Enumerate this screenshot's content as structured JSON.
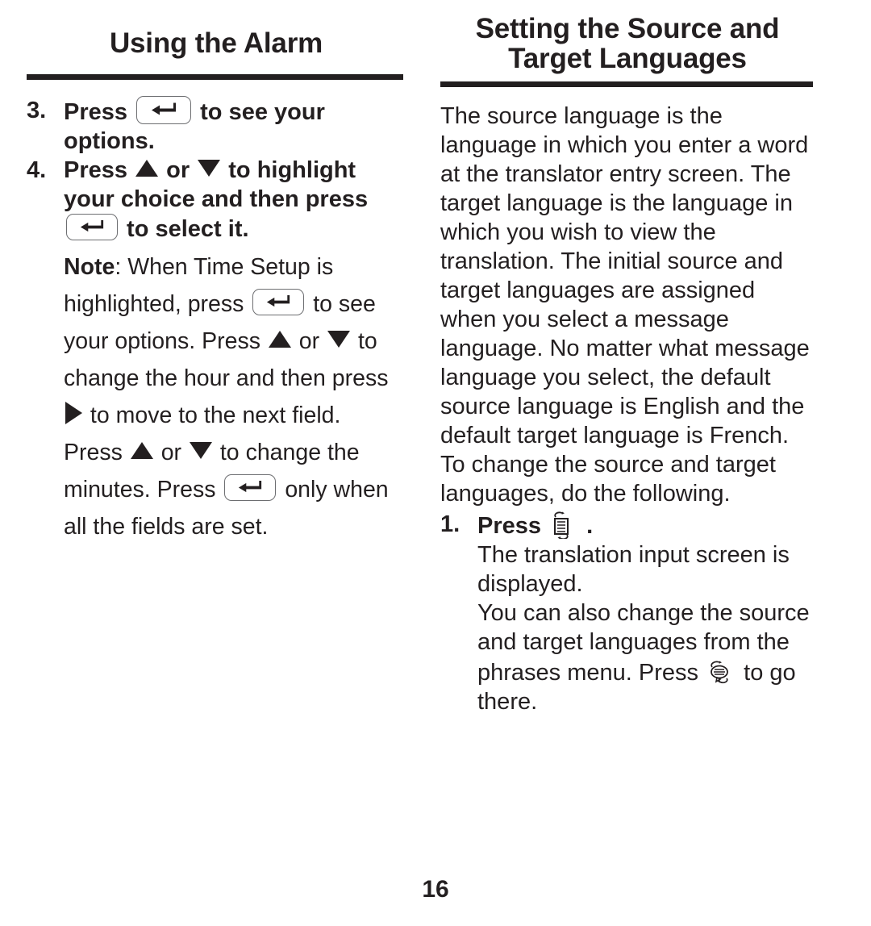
{
  "page": {
    "number": "16",
    "text_color": "#231f20",
    "rule_color": "#231f20"
  },
  "left_column": {
    "heading": "Using the Alarm",
    "steps": [
      {
        "number": "3.",
        "parts": [
          {
            "type": "text",
            "value": "Press "
          },
          {
            "type": "icon",
            "value": "enter-key-icon"
          },
          {
            "type": "text",
            "value": " to see your options."
          }
        ],
        "plain": "3. Press [enter key] to see your options."
      },
      {
        "number": "4.",
        "parts": [
          {
            "type": "text",
            "value": "Press "
          },
          {
            "type": "icon",
            "value": "up-arrow-icon"
          },
          {
            "type": "text",
            "value": " or "
          },
          {
            "type": "icon",
            "value": "down-arrow-icon"
          },
          {
            "type": "text",
            "value": " to highlight your choice and then press "
          },
          {
            "type": "icon",
            "value": "enter-key-icon"
          },
          {
            "type": "text",
            "value": " to select it."
          }
        ],
        "plain": "4. Press [up] or [down] to highlight your choice and then press [enter key] to select it."
      }
    ],
    "note": {
      "label": "Note",
      "colon": ": ",
      "seg1": "When Time Setup is highlighted, press ",
      "seg2": " to see your options. Press ",
      "seg3": " or ",
      "seg4": " to change the hour and then press ",
      "seg5": " to move to the next field. Press ",
      "seg6": " or ",
      "seg7": " to change the minutes. Press ",
      "seg8": " only when all the fields are set.",
      "plain": "Note: When Time Setup is highlighted, press [enter key] to see your options. Press [up] or [down] to change the hour and then press [right] to move to the next field. Press [up] or [down] to change the minutes. Press [enter key] only when all the fields are set."
    }
  },
  "right_column": {
    "heading_line1": "Setting the Source and",
    "heading_line2": "Target Languages",
    "intro": "The source language is the language in which you enter a word at the translator entry screen. The target language is the language in which you wish to view the translation. The initial source and target languages are assigned when you select a message language. No matter what message language you select, the default source language is English and the default target language is French. To change the source and target languages, do the following.",
    "step": {
      "number": "1.",
      "text_before": "Press ",
      "icon": "translate-icon",
      "text_after": " ."
    },
    "sub_paragraph_1": "The translation input screen is displayed.",
    "sub_paragraph_2_before": "You can also change the source and target languages from the phrases menu. Press ",
    "sub_paragraph_2_icon": "phrases-icon",
    "sub_paragraph_2_after": " to go there."
  }
}
